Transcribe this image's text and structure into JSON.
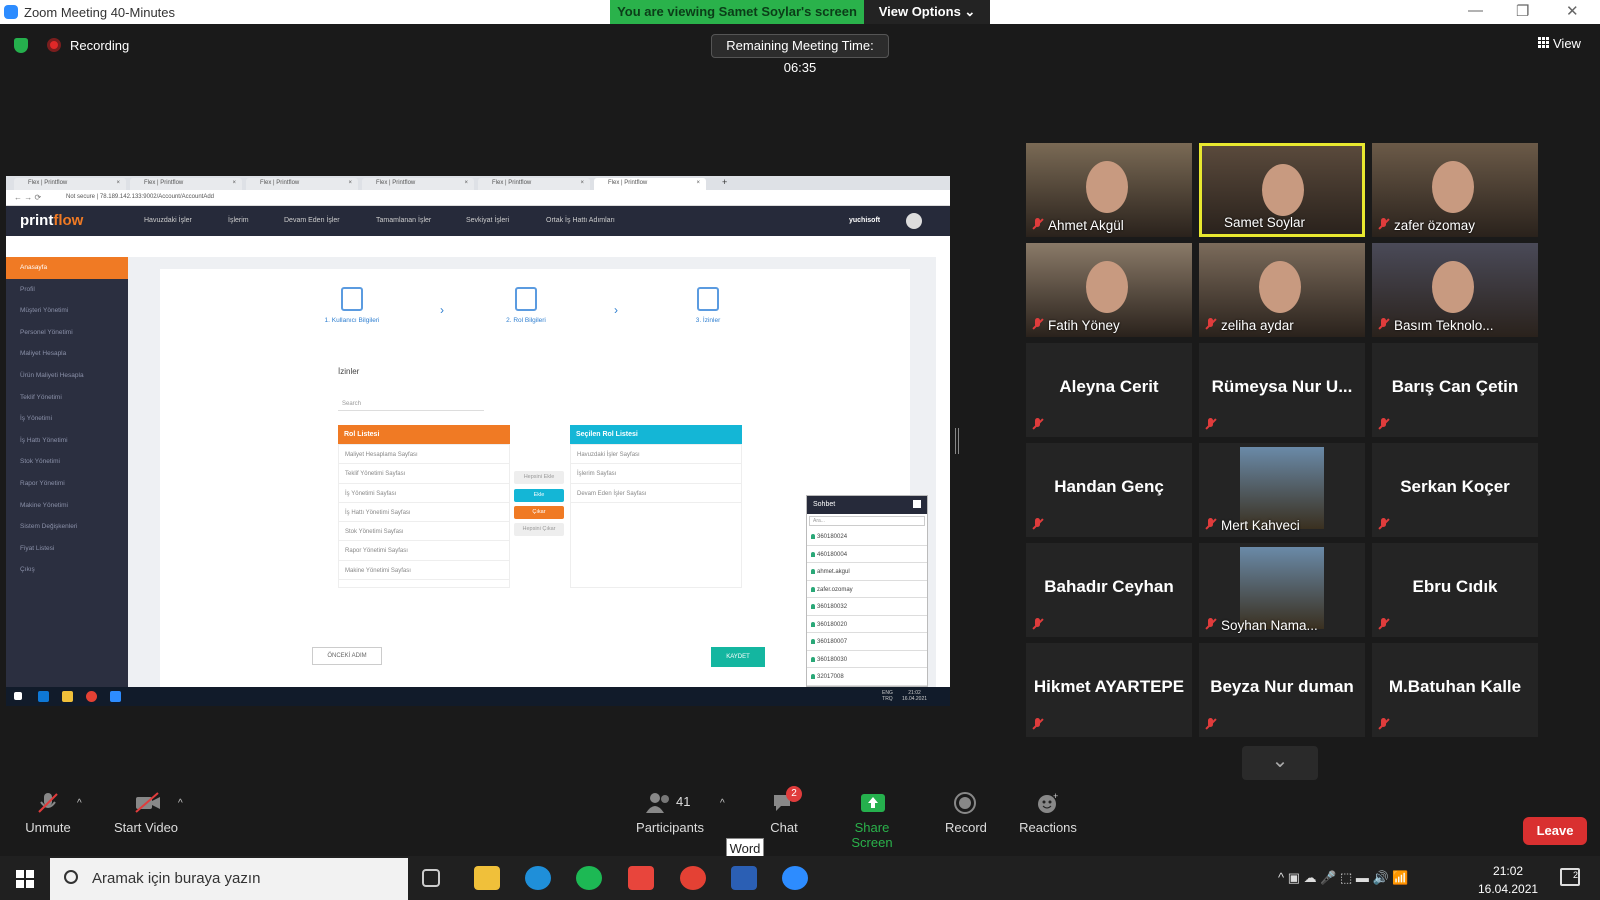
{
  "window": {
    "title": "Zoom Meeting 40-Minutes",
    "minimize": "—",
    "restore": "❐",
    "close": "✕"
  },
  "banner": {
    "viewing": "You are viewing Samet Soylar's screen",
    "view_options": "View Options ⌄"
  },
  "status": {
    "recording": "Recording",
    "remaining": "Remaining Meeting Time: 06:35",
    "view": "View"
  },
  "shared_screen": {
    "tabs": [
      "Flex | Printflow",
      "Flex | Printflow",
      "Flex | Printflow",
      "Flex | Printflow",
      "Flex | Printflow",
      "Flex | Printflow"
    ],
    "tab_close": "×",
    "new_tab": "+",
    "url": "Not secure  |  78.189.142.133:9002/Account/AccountAdd",
    "nav_arrows": "←  →  ⟳",
    "logo_main": "print",
    "logo_accent": "flow",
    "top_nav": [
      "Havuzdaki İşler",
      "İşlerim",
      "Devam Eden İşler",
      "Tamamlanan İşler",
      "Sevkiyat İşleri",
      "Ortak İş Hattı Adımları"
    ],
    "user": "yuchisoft",
    "sidebar": [
      "Anasayfa",
      "Profil",
      "Müşteri Yönetimi",
      "Personel Yönetimi",
      "Maliyet Hesapla",
      "Ürün Maliyeti Hesapla",
      "Teklif Yönetimi",
      "İş Yönetimi",
      "İş Hattı Yönetimi",
      "Stok Yönetimi",
      "Rapor Yönetimi",
      "Makine Yönetimi",
      "Sistem Değişkenleri",
      "Fiyat Listesi",
      "Çıkış"
    ],
    "steps": [
      "1. Kullanıcı Bilgileri",
      "2. Rol Bilgileri",
      "3. İzinler"
    ],
    "step_chevron": "›",
    "section_title": "İzinler",
    "search_placeholder": "Search",
    "rol_list_title": "Rol Listesi",
    "rol_items": [
      "Maliyet Hesaplama Sayfası",
      "Teklif Yönetimi Sayfası",
      "İş Yönetimi Sayfası",
      "İş Hattı Yönetimi Sayfası",
      "Stok Yönetimi Sayfası",
      "Rapor Yönetimi Sayfası",
      "Makine Yönetimi Sayfası"
    ],
    "selected_title": "Seçilen Rol Listesi",
    "selected_items": [
      "Havuzdaki İşler Sayfası",
      "İşlerim Sayfası",
      "Devam Eden İşler Sayfası"
    ],
    "mid_buttons": [
      "Hepsini Ekle",
      "Ekle",
      "Çıkar",
      "Hepsini Çıkar"
    ],
    "prev_button": "ÖNCEKİ ADIM",
    "save_button": "KAYDET",
    "chat_title": "Sohbet",
    "chat_search": "Ara...",
    "chat_users": [
      "360180024",
      "460180004",
      "ahmet.akgul",
      "zafer.ozomay",
      "360180032",
      "360180020",
      "360180007",
      "360180030",
      "32017008"
    ],
    "taskbar_clock": [
      "21:02",
      "16.04.2021"
    ],
    "taskbar_lang": [
      "ENG",
      "TRQ"
    ]
  },
  "participants": [
    {
      "name": "Ahmet Akgül",
      "video": true
    },
    {
      "name": "Samet Soylar",
      "video": true,
      "speaking": true
    },
    {
      "name": "zafer özomay",
      "video": true
    },
    {
      "name": "Fatih Yöney",
      "video": true
    },
    {
      "name": "zeliha aydar",
      "video": true
    },
    {
      "name": "Basım Teknolo...",
      "video": true
    },
    {
      "name": "Aleyna Cerit",
      "video": false
    },
    {
      "name": "Rümeysa Nur U...",
      "video": false
    },
    {
      "name": "Barış Can Çetin",
      "video": false
    },
    {
      "name": "Handan Genç",
      "video": false
    },
    {
      "name": "Mert Kahveci",
      "video": true,
      "photo": true
    },
    {
      "name": "Serkan Koçer",
      "video": false
    },
    {
      "name": "Bahadır Ceyhan",
      "video": false
    },
    {
      "name": "Soyhan Nama...",
      "video": true,
      "photo": true
    },
    {
      "name": "Ebru Cıdık",
      "video": false
    },
    {
      "name": "Hikmet AYARTEPE",
      "video": false
    },
    {
      "name": "Beyza Nur duman",
      "video": false
    },
    {
      "name": "M.Batuhan Kalle",
      "video": false
    }
  ],
  "gallery_scroll": "⌄",
  "toolbar": {
    "unmute": "Unmute",
    "start_video": "Start Video",
    "participants": "Participants",
    "participants_count": "41",
    "chat": "Chat",
    "chat_badge": "2",
    "share_screen": "Share Screen",
    "record": "Record",
    "reactions": "Reactions",
    "leave": "Leave",
    "tooltip": "Word",
    "caret": "^"
  },
  "windows_taskbar": {
    "search_placeholder": "Aramak için buraya yazın",
    "time": "21:02",
    "date": "16.04.2021",
    "notif_count": "2",
    "tray_icons": "^  ▣  ☁  🎤  ⬚  ▬  🔊  📶"
  },
  "colors": {
    "zoom_green": "#2ab24b",
    "leave_red": "#d93030",
    "speaker_yellow": "#e8e82f",
    "printflow_orange": "#f07a24",
    "printflow_cyan": "#14b6d6"
  }
}
